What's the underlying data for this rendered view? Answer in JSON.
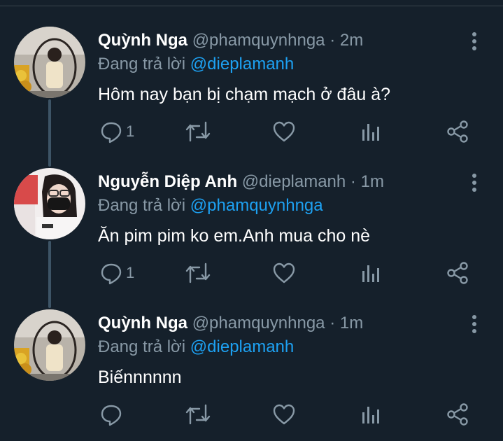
{
  "tweets": [
    {
      "name": "Quỳnh Nga",
      "handle": "@phamquynhnga",
      "separator": "·",
      "time": "2m",
      "replying_prefix": "Đang trả lời",
      "replying_to": "@dieplamanh",
      "text": "Hôm nay bạn bị chạm mạch ở đâu à?",
      "reply_count": "1",
      "avatar": "woman-on-hanging-chair-photo"
    },
    {
      "name": "Nguyễn Diệp Anh",
      "handle": "@dieplamanh",
      "separator": "·",
      "time": "1m",
      "replying_prefix": "Đang trả lời",
      "replying_to": "@phamquynhnga",
      "text": "Ăn pim pim ko em.Anh mua cho nè",
      "reply_count": "1",
      "avatar": "masked-woman-selfie-photo"
    },
    {
      "name": "Quỳnh Nga",
      "handle": "@phamquynhnga",
      "separator": "·",
      "time": "1m",
      "replying_prefix": "Đang trả lời",
      "replying_to": "@dieplamanh",
      "text": "Biếnnnnnn",
      "reply_count": "",
      "avatar": "woman-on-hanging-chair-photo"
    }
  ],
  "icons": {
    "reply": "reply-icon",
    "retweet": "retweet-icon",
    "like": "heart-icon",
    "analytics": "analytics-icon",
    "share": "share-icon",
    "more": "more-vertical-icon"
  },
  "colors": {
    "background": "#15202b",
    "text": "#ffffff",
    "muted": "#8899a6",
    "link": "#1da1f2",
    "connector": "#3d5466"
  }
}
